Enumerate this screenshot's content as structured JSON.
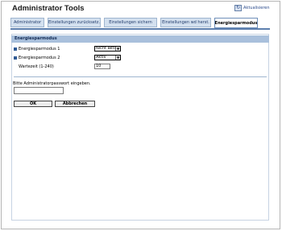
{
  "header": {
    "title": "Administrator Tools",
    "update_label": "Aktualisieren"
  },
  "tabs": [
    {
      "label": "Administrator"
    },
    {
      "label": "Einstellungen zurücksetz."
    },
    {
      "label": "Einstellungen sichern"
    },
    {
      "label": "Einstellungen wd herst."
    },
    {
      "label": "Energiesparmodus"
    }
  ],
  "section": {
    "title": "Energiesparmodus"
  },
  "fields": {
    "mode1": {
      "label": "Energiesparmodus 1",
      "value": "Nicht aktiv"
    },
    "mode2": {
      "label": "Energiesparmodus 2",
      "value": "Aktiv"
    },
    "wait": {
      "label": "Wartezeit (1-240)",
      "value": "10"
    }
  },
  "password": {
    "label": "Bitte Administratorpasswort eingeben.",
    "value": ""
  },
  "buttons": {
    "ok": "OK",
    "cancel": "Abbrechen"
  },
  "colors": {
    "tab_bg": "#d3e0ef",
    "section_bg": "#a9c0dc",
    "accent": "#2f5a95"
  }
}
